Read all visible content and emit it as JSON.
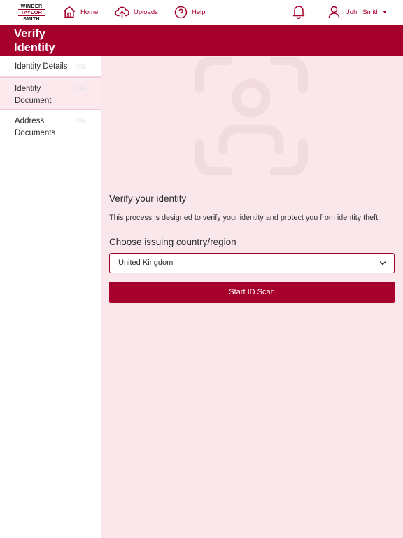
{
  "brand": {
    "logo_line1": "WINDER",
    "logo_line2": "TAYLOR",
    "logo_line3": "SMITH",
    "accent_color": "#a6002c",
    "background_tint": "#f9e7eb"
  },
  "nav": {
    "home_label": "Home",
    "home_icon": "home-icon",
    "uploads_label": "Uploads",
    "uploads_icon": "cloud-upload-icon",
    "help_label": "Help",
    "help_icon": "question-circle-icon",
    "notifications_icon": "bell-icon",
    "user_name": "John Smith",
    "user_icon": "user-icon"
  },
  "page": {
    "title": "Verify Identity"
  },
  "sidebar": {
    "items": [
      {
        "label": "Identity Details",
        "progress": "0%",
        "active": false
      },
      {
        "label": "Identity Document",
        "progress": "0%",
        "active": true
      },
      {
        "label": "Address Documents",
        "progress": "0%",
        "active": false
      }
    ]
  },
  "main": {
    "illustration_icon": "id-photo-placeholder-icon",
    "heading": "Verify your identity",
    "description": "This process is designed to verify your identity and protect you from identity theft.",
    "country_label": "Choose issuing country/region",
    "country_value": "United Kingdom",
    "scan_button_label": "Start ID Scan"
  }
}
